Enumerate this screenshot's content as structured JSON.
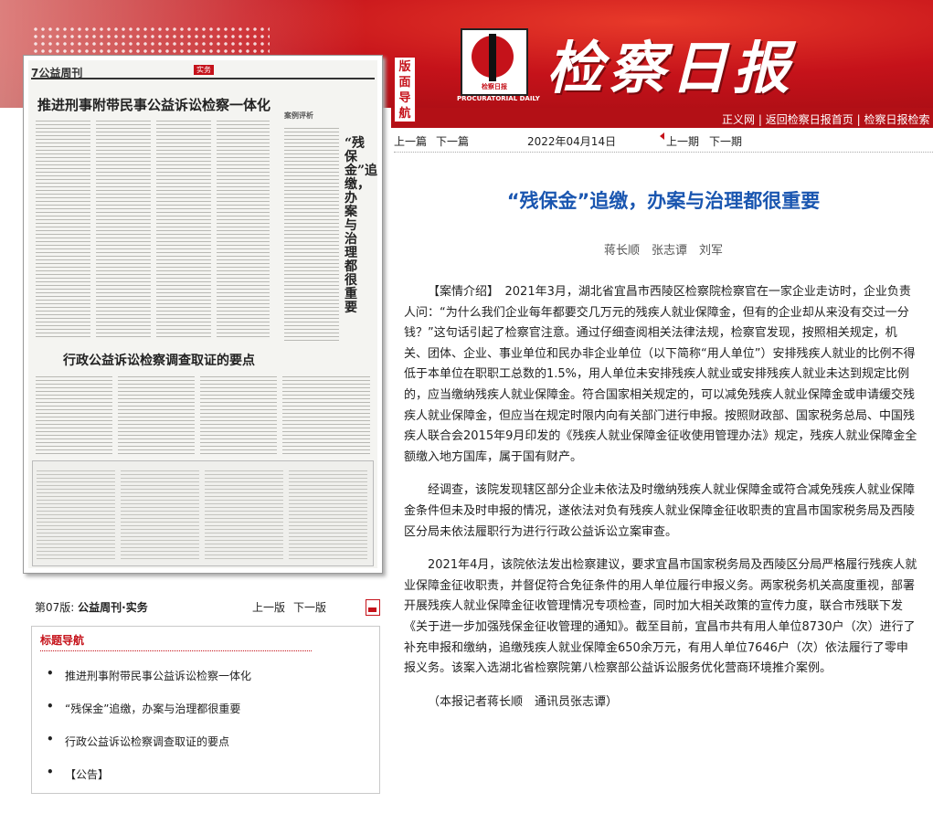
{
  "masthead": {
    "title": "检察日报",
    "logo_caption": "检察日报",
    "logo_en": "PROCURATORIAL DAILY",
    "vertical_guide": "版面导航",
    "links": [
      "正义网",
      "返回检察日报首页",
      "检察日报检索"
    ],
    "link_separator": "|"
  },
  "thumbnail": {
    "page_no": "7公益周刊",
    "tag": "实务",
    "headline_1": "推进刑事附带民事公益诉讼检察一体化",
    "headline_2": "行政公益诉讼检察调查取证的要点",
    "vertical_title": "“残保金”追缴，办案与治理都很重要",
    "case_label": "案例评析"
  },
  "page_nav": {
    "page_label": "第07版:",
    "page_name": "公益周刊·实务",
    "prev": "上一版",
    "next": "下一版"
  },
  "headline_nav": {
    "title": "标题导航",
    "items": [
      "推进刑事附带民事公益诉讼检察一体化",
      "“残保金”追缴，办案与治理都很重要",
      "行政公益诉讼检察调查取证的要点",
      "【公告】"
    ]
  },
  "article_nav": {
    "prev_article": "上一篇",
    "next_article": "下一篇",
    "date": "2022年04月14日",
    "prev_issue": "上一期",
    "next_issue": "下一期"
  },
  "article": {
    "title": "“残保金”追缴，办案与治理都很重要",
    "authors": "蒋长顺　张志谭　刘军",
    "paragraphs": [
      "【案情介绍】　2021年3月，湖北省宜昌市西陵区检察院检察官在一家企业走访时，企业负责人问：“为什么我们企业每年都要交几万元的残疾人就业保障金，但有的企业却从来没有交过一分钱？”这句话引起了检察官注意。通过仔细查阅相关法律法规，检察官发现，按照相关规定，机关、团体、企业、事业单位和民办非企业单位（以下简称“用人单位”）安排残疾人就业的比例不得低于本单位在职职工总数的1.5%，用人单位未安排残疾人就业或安排残疾人就业未达到规定比例的，应当缴纳残疾人就业保障金。符合国家相关规定的，可以减免残疾人就业保障金或申请缓交残疾人就业保障金，但应当在规定时限内向有关部门进行申报。按照财政部、国家税务总局、中国残疾人联合会2015年9月印发的《残疾人就业保障金征收使用管理办法》规定，残疾人就业保障金全额缴入地方国库，属于国有财产。",
      "经调查，该院发现辖区部分企业未依法及时缴纳残疾人就业保障金或符合减免残疾人就业保障金条件但未及时申报的情况，遂依法对负有残疾人就业保障金征收职责的宜昌市国家税务局及西陵区分局未依法履职行为进行行政公益诉讼立案审查。",
      "2021年4月，该院依法发出检察建议，要求宜昌市国家税务局及西陵区分局严格履行残疾人就业保障金征收职责，并督促符合免征条件的用人单位履行申报义务。两家税务机关高度重视，部署开展残疾人就业保障金征收管理情况专项检查，同时加大相关政策的宣传力度，联合市残联下发《关于进一步加强残保金征收管理的通知》。截至目前，宜昌市共有用人单位8730户（次）进行了补充申报和缴纳，追缴残疾人就业保障金650余万元，有用人单位7646户（次）依法履行了零申报义务。该案入选湖北省检察院第八检察部公益诉讼服务优化营商环境推介案例。"
    ],
    "byline": "（本报记者蒋长顺　通讯员张志谭）"
  }
}
